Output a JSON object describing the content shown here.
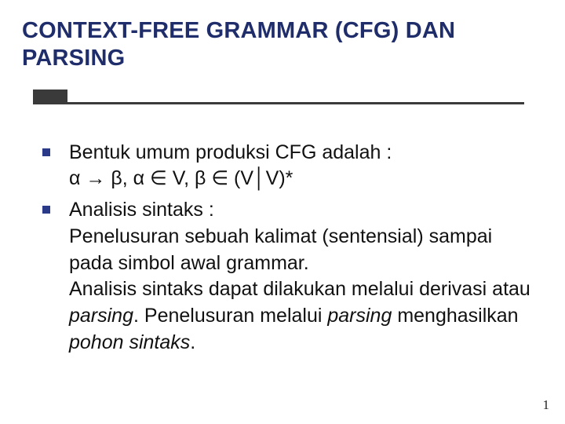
{
  "title": "CONTEXT-FREE GRAMMAR (CFG) DAN PARSING",
  "bullets": [
    {
      "line1": "Bentuk umum produksi CFG adalah :",
      "line2": "α → β,   α ∈ V,   β ∈ (V│V)*"
    },
    {
      "line1": "Analisis sintaks :",
      "line2": "Penelusuran sebuah kalimat (sentensial) sampai pada simbol awal grammar."
    }
  ],
  "tail": {
    "t1": "Analisis sintaks dapat dilakukan melalui derivasi atau ",
    "t2_italic": "parsing",
    "t3": ". Penelusuran melalui ",
    "t4_italic": "parsing",
    "t5": " menghasilkan ",
    "t6_italic": "pohon sintaks",
    "t7": "."
  },
  "page_number": "1"
}
